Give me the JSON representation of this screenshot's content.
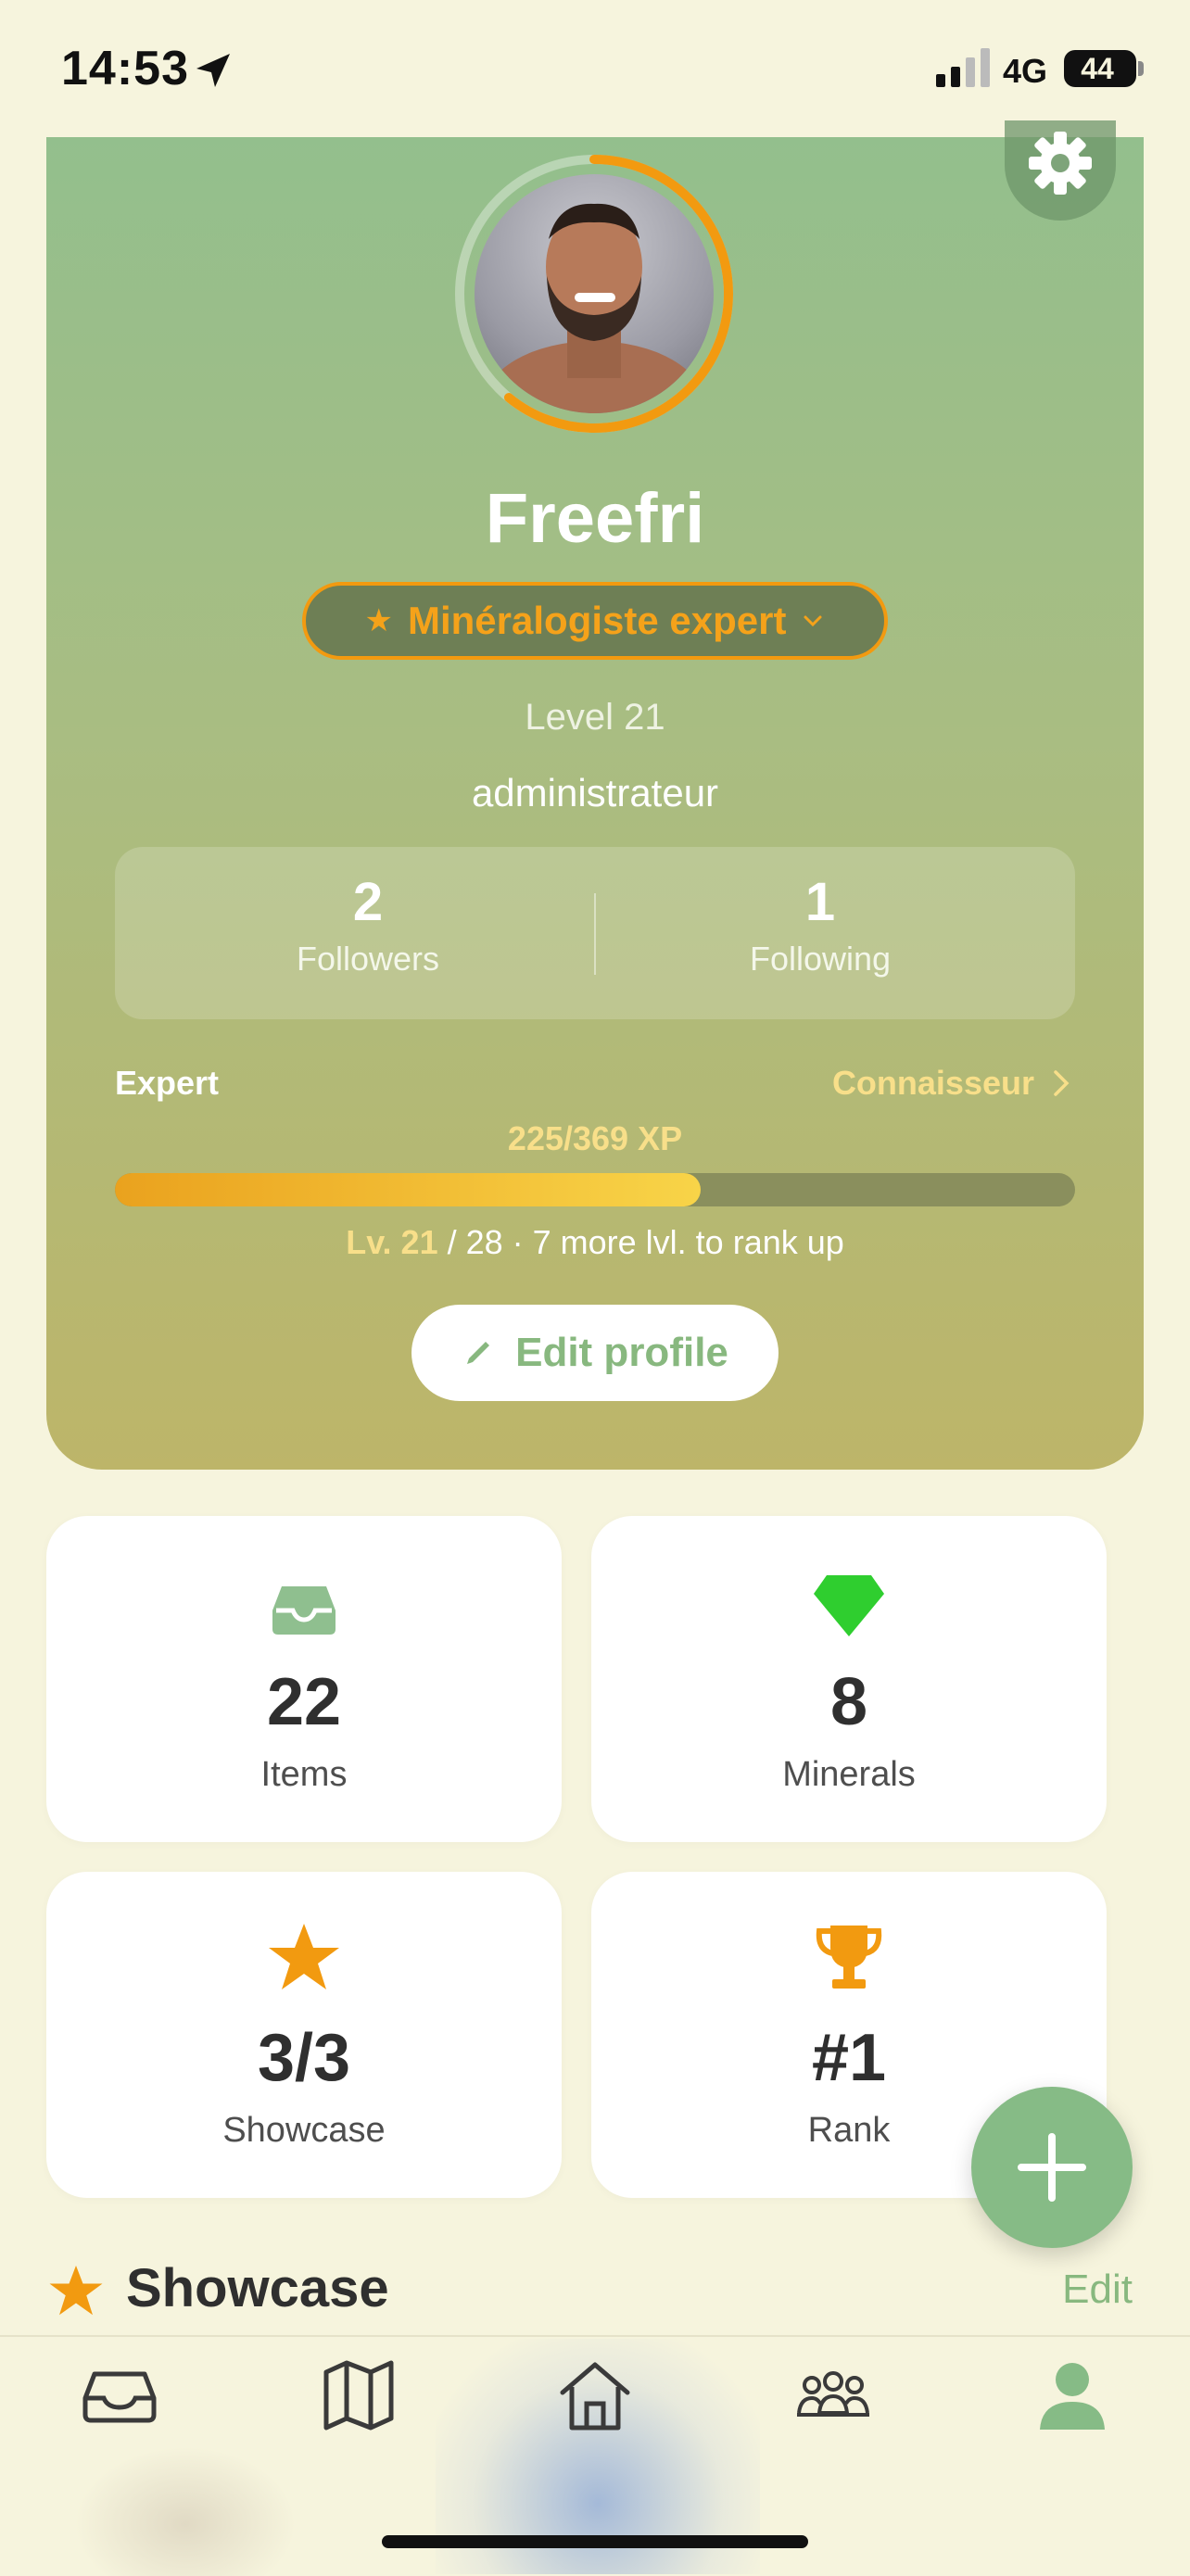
{
  "status_bar": {
    "time": "14:53",
    "network": "4G",
    "battery": "44"
  },
  "profile": {
    "username": "Freefri",
    "title": "Minéralogiste expert",
    "level_text": "Level 21",
    "role": "administrateur",
    "followers": {
      "count": "2",
      "label": "Followers"
    },
    "following": {
      "count": "1",
      "label": "Following"
    },
    "current_rank": "Expert",
    "next_rank": "Connaisseur",
    "xp_text": "225/369 XP",
    "xp_progress": 0.61,
    "level_line": {
      "current": "Lv. 21",
      "rest": " / 28 · 7 more lvl. to rank up"
    },
    "edit_button": "Edit profile"
  },
  "stats": [
    {
      "value": "22",
      "label": "Items",
      "icon": "inbox-icon"
    },
    {
      "value": "8",
      "label": "Minerals",
      "icon": "gem-icon"
    },
    {
      "value": "3/3",
      "label": "Showcase",
      "icon": "star-icon"
    },
    {
      "value": "#1",
      "label": "Rank",
      "icon": "trophy-icon"
    }
  ],
  "showcase": {
    "title": "Showcase",
    "edit": "Edit"
  },
  "tabs": [
    {
      "name": "inbox",
      "icon": "inbox-icon"
    },
    {
      "name": "map",
      "icon": "map-icon"
    },
    {
      "name": "home",
      "icon": "home-icon"
    },
    {
      "name": "community",
      "icon": "people-icon"
    },
    {
      "name": "profile",
      "icon": "user-icon",
      "active": true
    }
  ],
  "colors": {
    "accent_green": "#88b87f",
    "accent_orange": "#f29a10",
    "gem_green": "#2fce2f",
    "background": "#f6f4dd"
  }
}
